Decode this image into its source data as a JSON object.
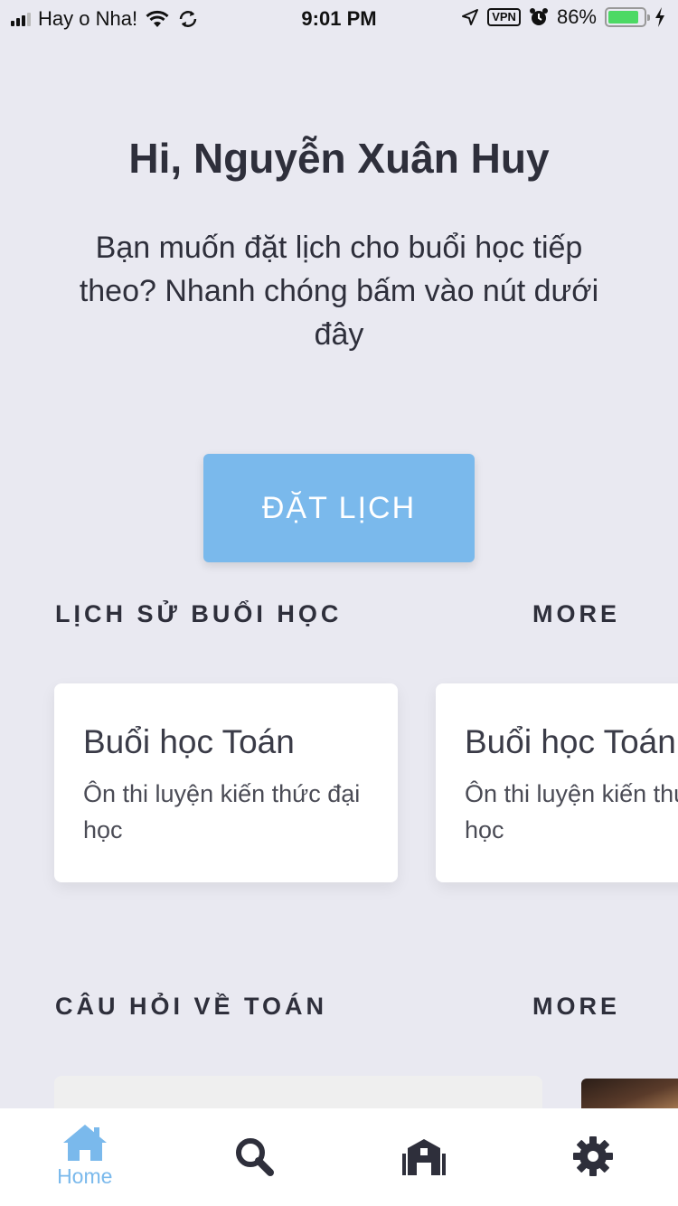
{
  "status_bar": {
    "carrier": "Hay o Nha!",
    "time": "9:01 PM",
    "vpn": "VPN",
    "battery_percent": "86%",
    "battery_level": 0.86
  },
  "greeting": "Hi, Nguyễn Xuân Huy",
  "intro": "Bạn muốn đặt lịch cho buổi học tiếp theo? Nhanh chóng bấm vào nút dưới đây",
  "book_button": "ĐẶT LỊCH",
  "history": {
    "title": "LỊCH SỬ BUỔI HỌC",
    "more": "MORE",
    "cards": [
      {
        "title": "Buổi học Toán",
        "desc": "Ôn thi luyện kiến thức đại học"
      },
      {
        "title": "Buổi học Toán",
        "desc": "Ôn thi luyện kiến thức đại học"
      }
    ]
  },
  "questions": {
    "title": "CÂU HỎI VỀ TOÁN",
    "more": "MORE"
  },
  "tab_bar": {
    "items": [
      {
        "label": "Home",
        "icon": "home-icon",
        "active": true
      },
      {
        "label": "",
        "icon": "search-icon",
        "active": false
      },
      {
        "label": "",
        "icon": "school-icon",
        "active": false
      },
      {
        "label": "",
        "icon": "settings-icon",
        "active": false
      }
    ]
  },
  "colors": {
    "background": "#e9e9f1",
    "accent": "#7ab9ec",
    "text": "#2e2f3b",
    "card": "#ffffff",
    "battery": "#4cd964"
  }
}
